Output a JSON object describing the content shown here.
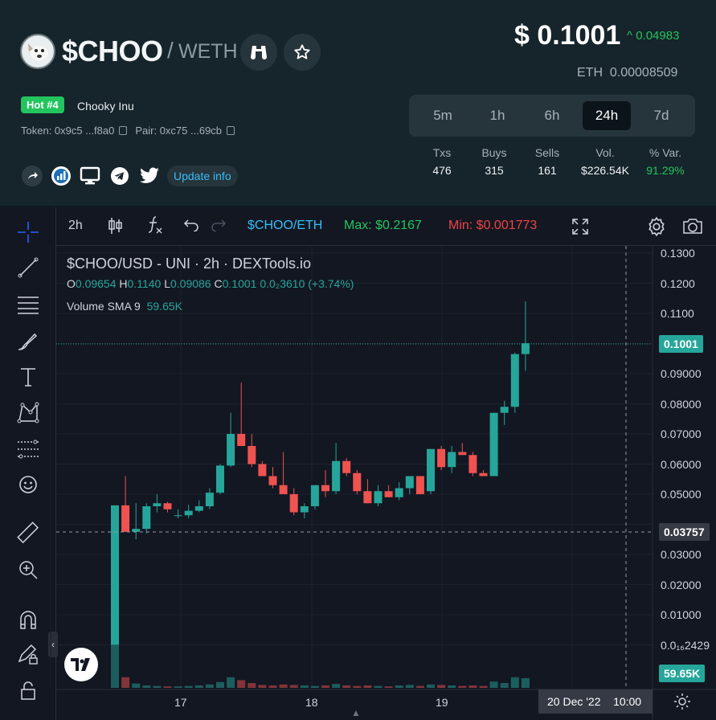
{
  "header": {
    "symbol": "$CHOO",
    "separator": "/",
    "quote": "WETH",
    "hot_badge": "Hot #4",
    "token_name": "Chooky Inu",
    "token_label": "Token: 0x9c5 ...f8a0",
    "pair_label": "Pair: 0xc75 ...69cb",
    "update_info": "Update info",
    "icons": [
      "binoculars-icon",
      "star-icon",
      "share-icon",
      "chart-icon",
      "monitor-icon",
      "telegram-icon",
      "twitter-icon"
    ]
  },
  "price": {
    "usd": "$ 0.1001",
    "change": "^ 0.04983",
    "eth_label": "ETH",
    "eth_value": "0.00008509",
    "change_color": "#22c55e"
  },
  "timeframes": [
    {
      "label": "5m",
      "active": false
    },
    {
      "label": "1h",
      "active": false
    },
    {
      "label": "6h",
      "active": false
    },
    {
      "label": "24h",
      "active": true
    },
    {
      "label": "7d",
      "active": false
    }
  ],
  "stats": [
    {
      "head": "Txs",
      "value": "476"
    },
    {
      "head": "Buys",
      "value": "315"
    },
    {
      "head": "Sells",
      "value": "161"
    },
    {
      "head": "Vol.",
      "value": "$226.54K"
    },
    {
      "head": "% Var.",
      "value": "91.29%"
    }
  ],
  "chart_toolbar": {
    "interval": "2h",
    "pair": "$CHOO/ETH",
    "max": "Max: $0.2167",
    "min": "Min: $0.001773"
  },
  "legend": {
    "title": "$CHOO/USD - UNI · 2h · DEXTools.io",
    "o_lbl": "O",
    "o": "0.09654",
    "h_lbl": "H",
    "h": "0.1140",
    "l_lbl": "L",
    "l": "0.09086",
    "c_lbl": "C",
    "c": "0.1001",
    "chg": "0.0₂3610 (+3.74%)",
    "vol_label": "Volume SMA 9",
    "vol_value": "59.65K"
  },
  "chart_data": {
    "type": "candlestick",
    "title": "$CHOO/USD - UNI · 2h · DEXTools.io",
    "y_ticks": [
      "0.1300",
      "0.1200",
      "0.1100",
      "0.1001",
      "0.09000",
      "0.08000",
      "0.07000",
      "0.06000",
      "0.05000",
      "0.03757",
      "0.03000",
      "0.02000",
      "0.01000",
      "0.0₁₆2429"
    ],
    "ylim": [
      0,
      0.13
    ],
    "x_ticks": [
      "17",
      "18",
      "19"
    ],
    "current_price_label": "0.1001",
    "crosshair_price_label": "0.03757",
    "volume_label": "59.65K",
    "crosshair_time_label": "20 Dec '22",
    "crosshair_time": "10:00",
    "up_color": "#26a69a",
    "down_color": "#ef5350",
    "candles": [
      [
        0.0001,
        0.0463,
        0.0001,
        0.0463
      ],
      [
        0.0463,
        0.056,
        0.038,
        0.0375
      ],
      [
        0.0375,
        0.047,
        0.035,
        0.0385
      ],
      [
        0.0385,
        0.047,
        0.037,
        0.046
      ],
      [
        0.046,
        0.05,
        0.044,
        0.047
      ],
      [
        0.047,
        0.0475,
        0.044,
        0.045
      ],
      [
        0.043,
        0.045,
        0.042,
        0.043
      ],
      [
        0.043,
        0.0465,
        0.042,
        0.0445
      ],
      [
        0.0445,
        0.048,
        0.044,
        0.046
      ],
      [
        0.046,
        0.052,
        0.045,
        0.0505
      ],
      [
        0.0505,
        0.06,
        0.05,
        0.0595
      ],
      [
        0.0595,
        0.077,
        0.059,
        0.07
      ],
      [
        0.07,
        0.087,
        0.066,
        0.066
      ],
      [
        0.066,
        0.07,
        0.059,
        0.06
      ],
      [
        0.06,
        0.061,
        0.056,
        0.056
      ],
      [
        0.056,
        0.059,
        0.052,
        0.053
      ],
      [
        0.053,
        0.064,
        0.05,
        0.05
      ],
      [
        0.05,
        0.052,
        0.043,
        0.044
      ],
      [
        0.044,
        0.047,
        0.042,
        0.046
      ],
      [
        0.046,
        0.053,
        0.045,
        0.053
      ],
      [
        0.053,
        0.058,
        0.049,
        0.051
      ],
      [
        0.051,
        0.067,
        0.05,
        0.061
      ],
      [
        0.061,
        0.062,
        0.056,
        0.057
      ],
      [
        0.057,
        0.058,
        0.05,
        0.051
      ],
      [
        0.051,
        0.055,
        0.047,
        0.047
      ],
      [
        0.047,
        0.053,
        0.046,
        0.051
      ],
      [
        0.051,
        0.053,
        0.049,
        0.049
      ],
      [
        0.049,
        0.054,
        0.048,
        0.052
      ],
      [
        0.052,
        0.056,
        0.05,
        0.056
      ],
      [
        0.056,
        0.056,
        0.05,
        0.05
      ],
      [
        0.051,
        0.065,
        0.05,
        0.065
      ],
      [
        0.065,
        0.066,
        0.058,
        0.059
      ],
      [
        0.059,
        0.066,
        0.057,
        0.064
      ],
      [
        0.064,
        0.067,
        0.063,
        0.063
      ],
      [
        0.063,
        0.064,
        0.056,
        0.057
      ],
      [
        0.057,
        0.058,
        0.056,
        0.056
      ],
      [
        0.056,
        0.077,
        0.056,
        0.077
      ],
      [
        0.077,
        0.081,
        0.073,
        0.079
      ],
      [
        0.079,
        0.097,
        0.077,
        0.0965
      ],
      [
        0.0965,
        0.114,
        0.0909,
        0.1001
      ]
    ],
    "volumes": [
      0.95,
      0.22,
      0.09,
      0.05,
      0.04,
      0.03,
      0.03,
      0.04,
      0.05,
      0.07,
      0.12,
      0.22,
      0.16,
      0.1,
      0.06,
      0.05,
      0.07,
      0.06,
      0.05,
      0.04,
      0.05,
      0.08,
      0.05,
      0.04,
      0.05,
      0.04,
      0.03,
      0.05,
      0.06,
      0.04,
      0.07,
      0.06,
      0.05,
      0.04,
      0.05,
      0.04,
      0.13,
      0.1,
      0.22,
      0.2
    ]
  }
}
